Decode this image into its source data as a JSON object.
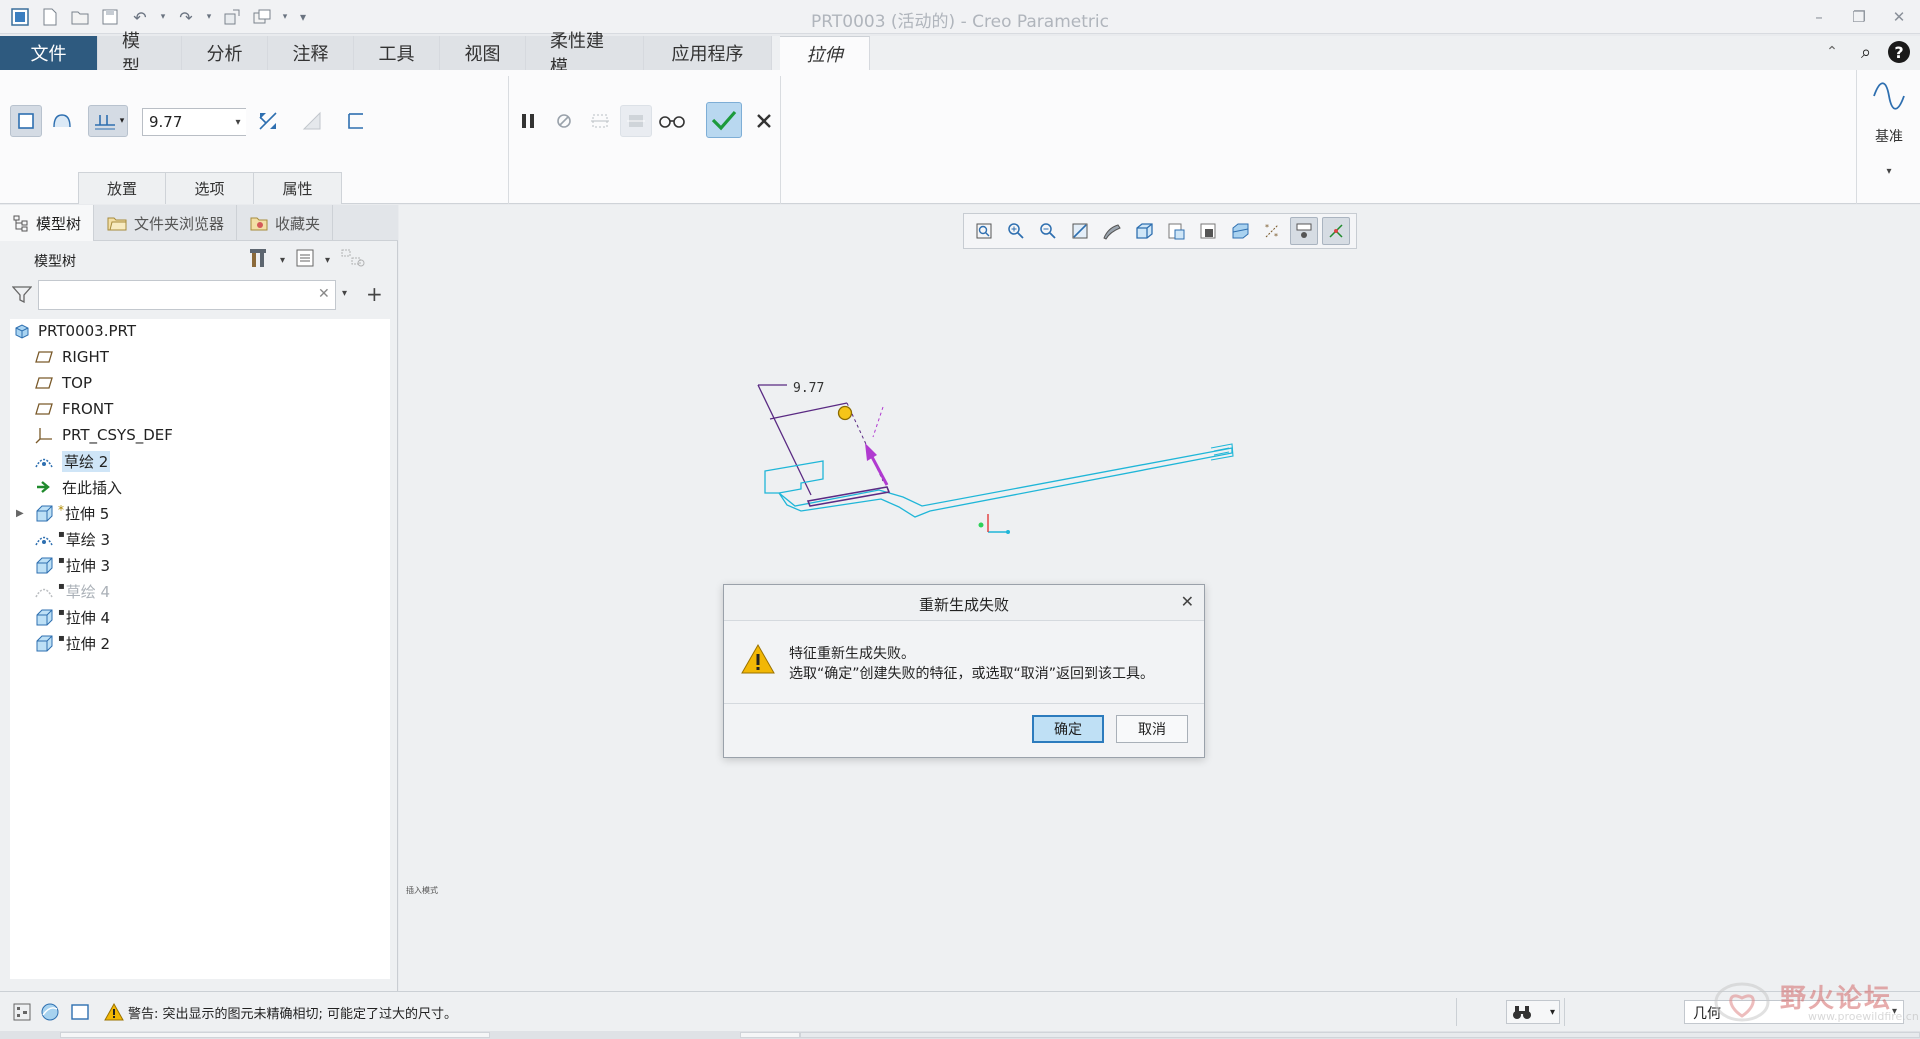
{
  "window": {
    "title": "PRT0003 (活动的) - Creo Parametric"
  },
  "ribbon_tabs": [
    {
      "label": "文件"
    },
    {
      "label": "模型"
    },
    {
      "label": "分析"
    },
    {
      "label": "注释"
    },
    {
      "label": "工具"
    },
    {
      "label": "视图"
    },
    {
      "label": "柔性建模"
    },
    {
      "label": "应用程序"
    },
    {
      "label": "拉伸",
      "active": true
    }
  ],
  "extrude": {
    "depth_value": "9.77",
    "subtabs": [
      "放置",
      "选项",
      "属性"
    ],
    "datum_label": "基准"
  },
  "nav_tabs": [
    "模型树",
    "文件夹浏览器",
    "收藏夹"
  ],
  "model_tree": {
    "title": "模型树",
    "search_value": "",
    "nodes": [
      {
        "label": "PRT0003.PRT",
        "icon": "part-icon"
      },
      {
        "label": "RIGHT",
        "icon": "datum-plane-icon"
      },
      {
        "label": "TOP",
        "icon": "datum-plane-icon"
      },
      {
        "label": "FRONT",
        "icon": "datum-plane-icon"
      },
      {
        "label": "PRT_CSYS_DEF",
        "icon": "csys-icon"
      },
      {
        "label": "草绘 2",
        "icon": "sketch-icon",
        "selected": true
      },
      {
        "label": "在此插入",
        "icon": "insert-here-arrow-icon"
      },
      {
        "label": "拉伸 5",
        "icon": "extrude-icon",
        "marker": "*",
        "expandable": true
      },
      {
        "label": "草绘 3",
        "icon": "sketch-icon",
        "marker": "▪"
      },
      {
        "label": "拉伸 3",
        "icon": "extrude-icon",
        "marker": "▪"
      },
      {
        "label": "草绘 4",
        "icon": "sketch-icon",
        "marker": "▪",
        "dim": true
      },
      {
        "label": "拉伸 4",
        "icon": "extrude-icon",
        "marker": "▪"
      },
      {
        "label": "拉伸 2",
        "icon": "extrude-icon",
        "marker": "▪"
      }
    ]
  },
  "graphics": {
    "dimension_text": "9.77",
    "insert_mode_text": "插入模式"
  },
  "dialog": {
    "title": "重新生成失败",
    "message_line1": "特征重新生成失败。",
    "message_line2": "选取“确定”创建失败的特征，或选取“取消”返回到该工具。",
    "ok_label": "确定",
    "cancel_label": "取消"
  },
  "statusbar": {
    "message": "警告: 突出显示的图元未精确相切; 可能定了过大的尺寸。",
    "filter_value": "几何"
  },
  "watermark": {
    "text": "野火论坛",
    "url": "www.proewildfire.cn"
  },
  "colors": {
    "file_tab": "#2e5a7f",
    "geometry_cyan": "#1fb6d8",
    "dimension_purple": "#5a2a83",
    "drag_handle_yellow": "#f5c518",
    "direction_arrow": "#b03ad0",
    "warning_yellow": "#f2b705",
    "selected_bg": "#cfe5f7"
  }
}
